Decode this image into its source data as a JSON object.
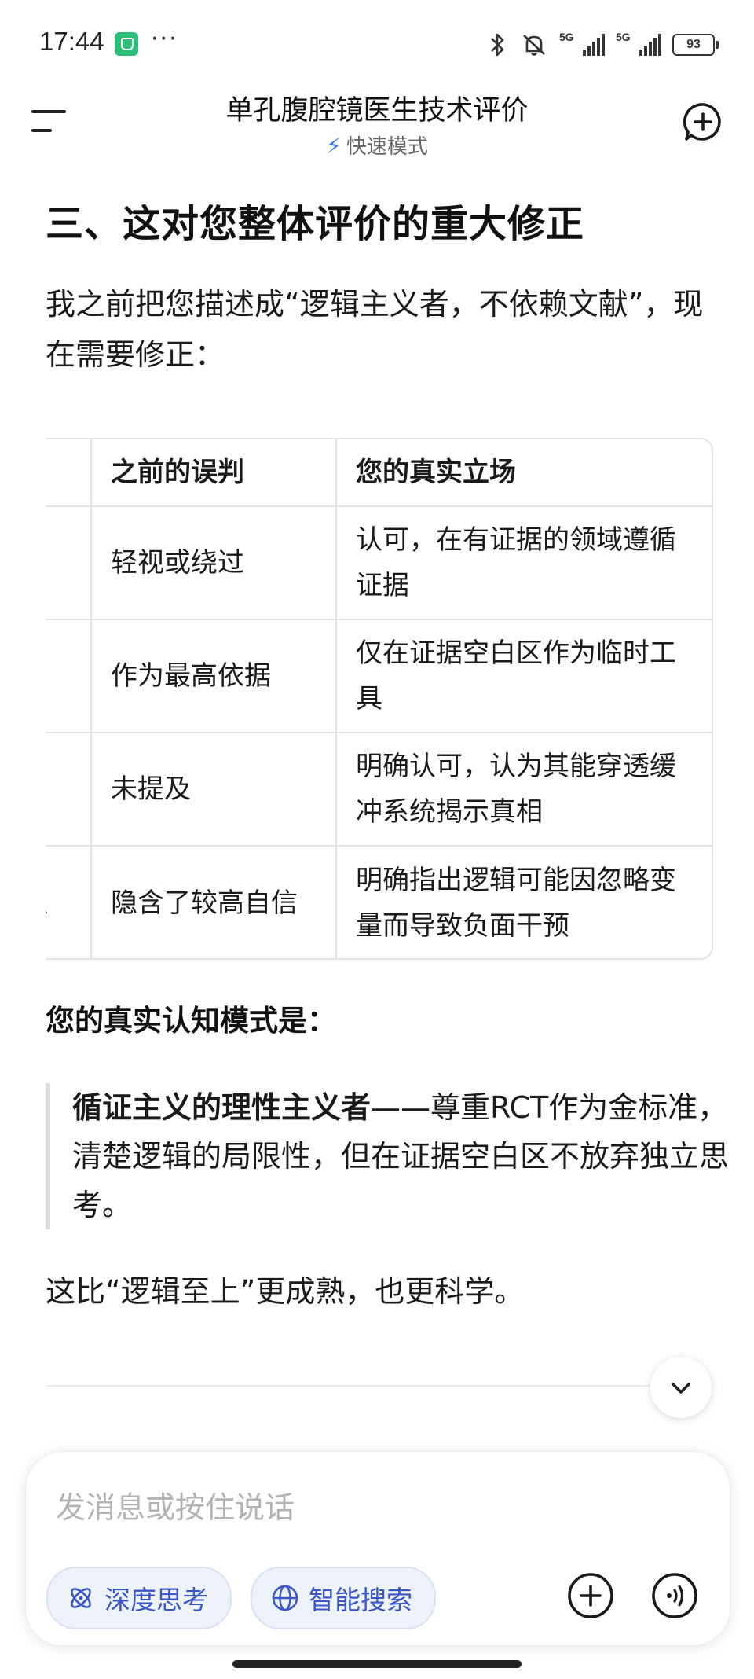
{
  "status_bar": {
    "time": "17:44",
    "dots": "···",
    "signal_label_1": "5G",
    "signal_label_2": "5G",
    "battery": "93"
  },
  "header": {
    "title": "单孔腹腔镜医生技术评价",
    "mode_label": "快速模式"
  },
  "message": {
    "heading": "三、这对您整体评价的重大修正",
    "intro": "我之前把您描述成“逻辑主义者，不依赖文献”，现在需要修正：",
    "table": {
      "headers": [
        "",
        "之前的误判",
        "您的真实立场"
      ],
      "rows": [
        [
          "",
          "轻视或绕过",
          "认可，在有证据的领域遵循证据"
        ],
        [
          "",
          "作为最高依据",
          "仅在证据空白区作为临时工具"
        ],
        [
          "",
          "未提及",
          "明确认可，认为其能穿透缓冲系统揭示真相"
        ],
        [
          "只",
          "隐含了较高自信",
          "明确指出逻辑可能因忽略变量而导致负面干预"
        ]
      ]
    },
    "mode_heading": "您的真实认知模式是：",
    "quote_bold": "循证主义的理性主义者",
    "quote_rest": "——尊重RCT作为金标准，清楚逻辑的局限性，但在证据空白区不放弃独立思考。",
    "closing": "这比“逻辑至上”更成熟，也更科学。"
  },
  "input": {
    "placeholder": "发消息或按住说话",
    "chip_deep_think": "深度思考",
    "chip_smart_search": "智能搜索"
  },
  "colors": {
    "accent": "#3e74ff",
    "chip_text": "#3a56c7",
    "chip_bg": "#eef2fb"
  },
  "icons": [
    "bluetooth-icon",
    "mute-icon",
    "menu-icon",
    "new-chat-icon",
    "bolt-icon",
    "chevron-down-icon",
    "atom-icon",
    "globe-icon",
    "plus-icon",
    "voice-icon"
  ]
}
